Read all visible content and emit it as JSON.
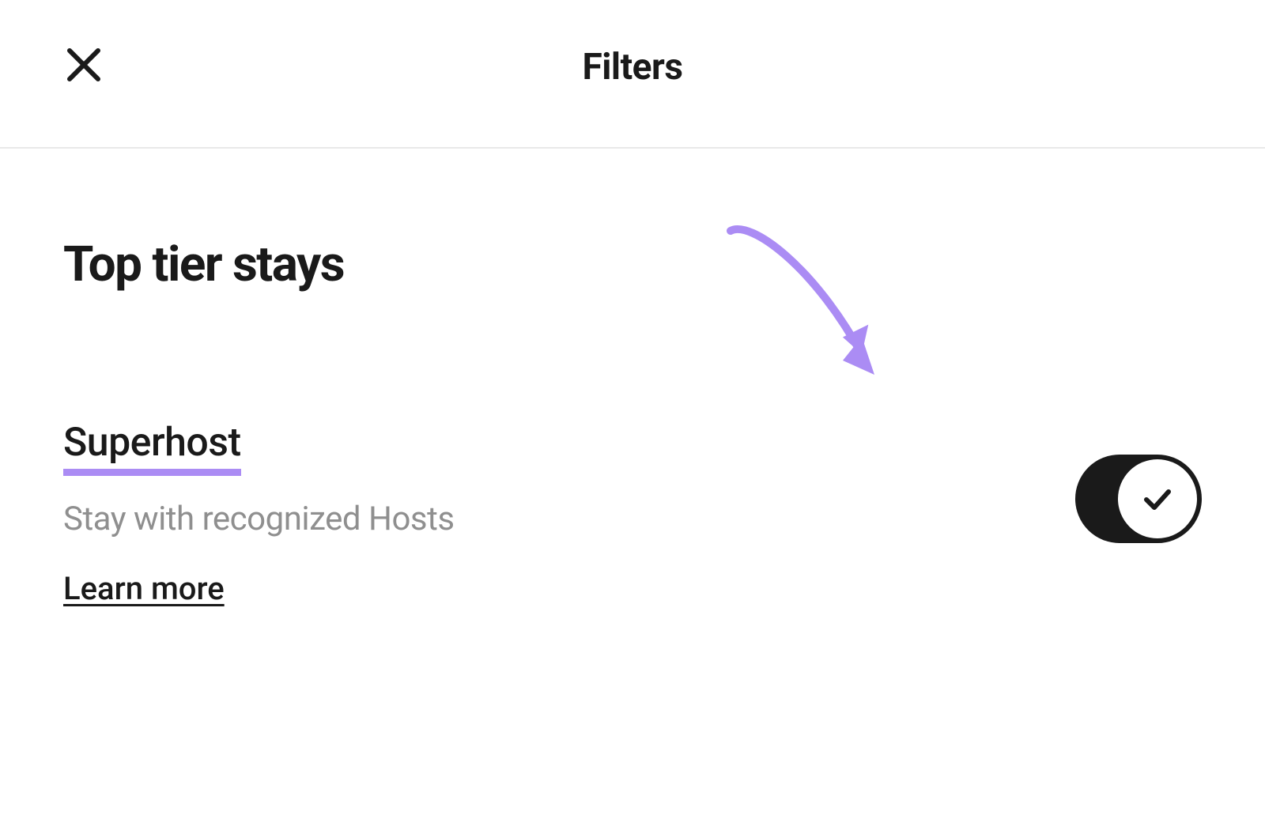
{
  "header": {
    "title": "Filters"
  },
  "section": {
    "title": "Top tier stays"
  },
  "option": {
    "title": "Superhost",
    "description": "Stay with recognized Hosts",
    "learn_more": "Learn more",
    "toggle_on": true
  },
  "colors": {
    "annotation": "#ab8cf4",
    "text_primary": "#1a1a1a",
    "text_secondary": "#8f8f8f",
    "divider": "#e9e9e9"
  }
}
